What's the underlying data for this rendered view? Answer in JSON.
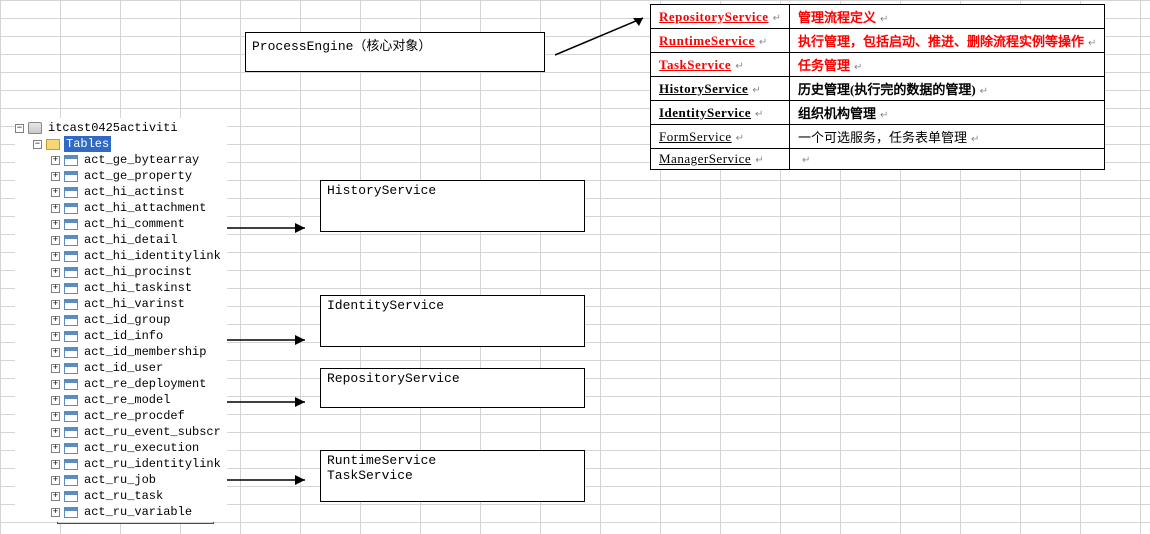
{
  "tree": {
    "root": "itcast0425activiti",
    "tablesLabel": "Tables",
    "tables": [
      "act_ge_bytearray",
      "act_ge_property",
      "act_hi_actinst",
      "act_hi_attachment",
      "act_hi_comment",
      "act_hi_detail",
      "act_hi_identitylink",
      "act_hi_procinst",
      "act_hi_taskinst",
      "act_hi_varinst",
      "act_id_group",
      "act_id_info",
      "act_id_membership",
      "act_id_user",
      "act_re_deployment",
      "act_re_model",
      "act_re_procdef",
      "act_ru_event_subscr",
      "act_ru_execution",
      "act_ru_identitylink",
      "act_ru_job",
      "act_ru_task",
      "act_ru_variable"
    ]
  },
  "processEngine": {
    "label": "ProcessEngine（核心对象）"
  },
  "services": {
    "history": "HistoryService",
    "identity": "IdentityService",
    "repository": "RepositoryService",
    "runtime": "RuntimeService",
    "task": "TaskService"
  },
  "descTable": [
    {
      "name": "RepositoryService",
      "desc": "管理流程定义",
      "red": true,
      "bold": true
    },
    {
      "name": "RuntimeService",
      "desc": "执行管理，包括启动、推进、删除流程实例等操作",
      "red": true,
      "bold": true
    },
    {
      "name": "TaskService",
      "desc": "任务管理",
      "red": true,
      "bold": true
    },
    {
      "name": "HistoryService",
      "desc": "历史管理(执行完的数据的管理)",
      "red": false,
      "bold": true
    },
    {
      "name": "IdentityService",
      "desc": "组织机构管理",
      "red": false,
      "bold": true
    },
    {
      "name": "FormService",
      "desc": "一个可选服务，任务表单管理",
      "red": false,
      "bold": false
    },
    {
      "name": "ManagerService",
      "desc": "",
      "red": false,
      "bold": false
    }
  ]
}
